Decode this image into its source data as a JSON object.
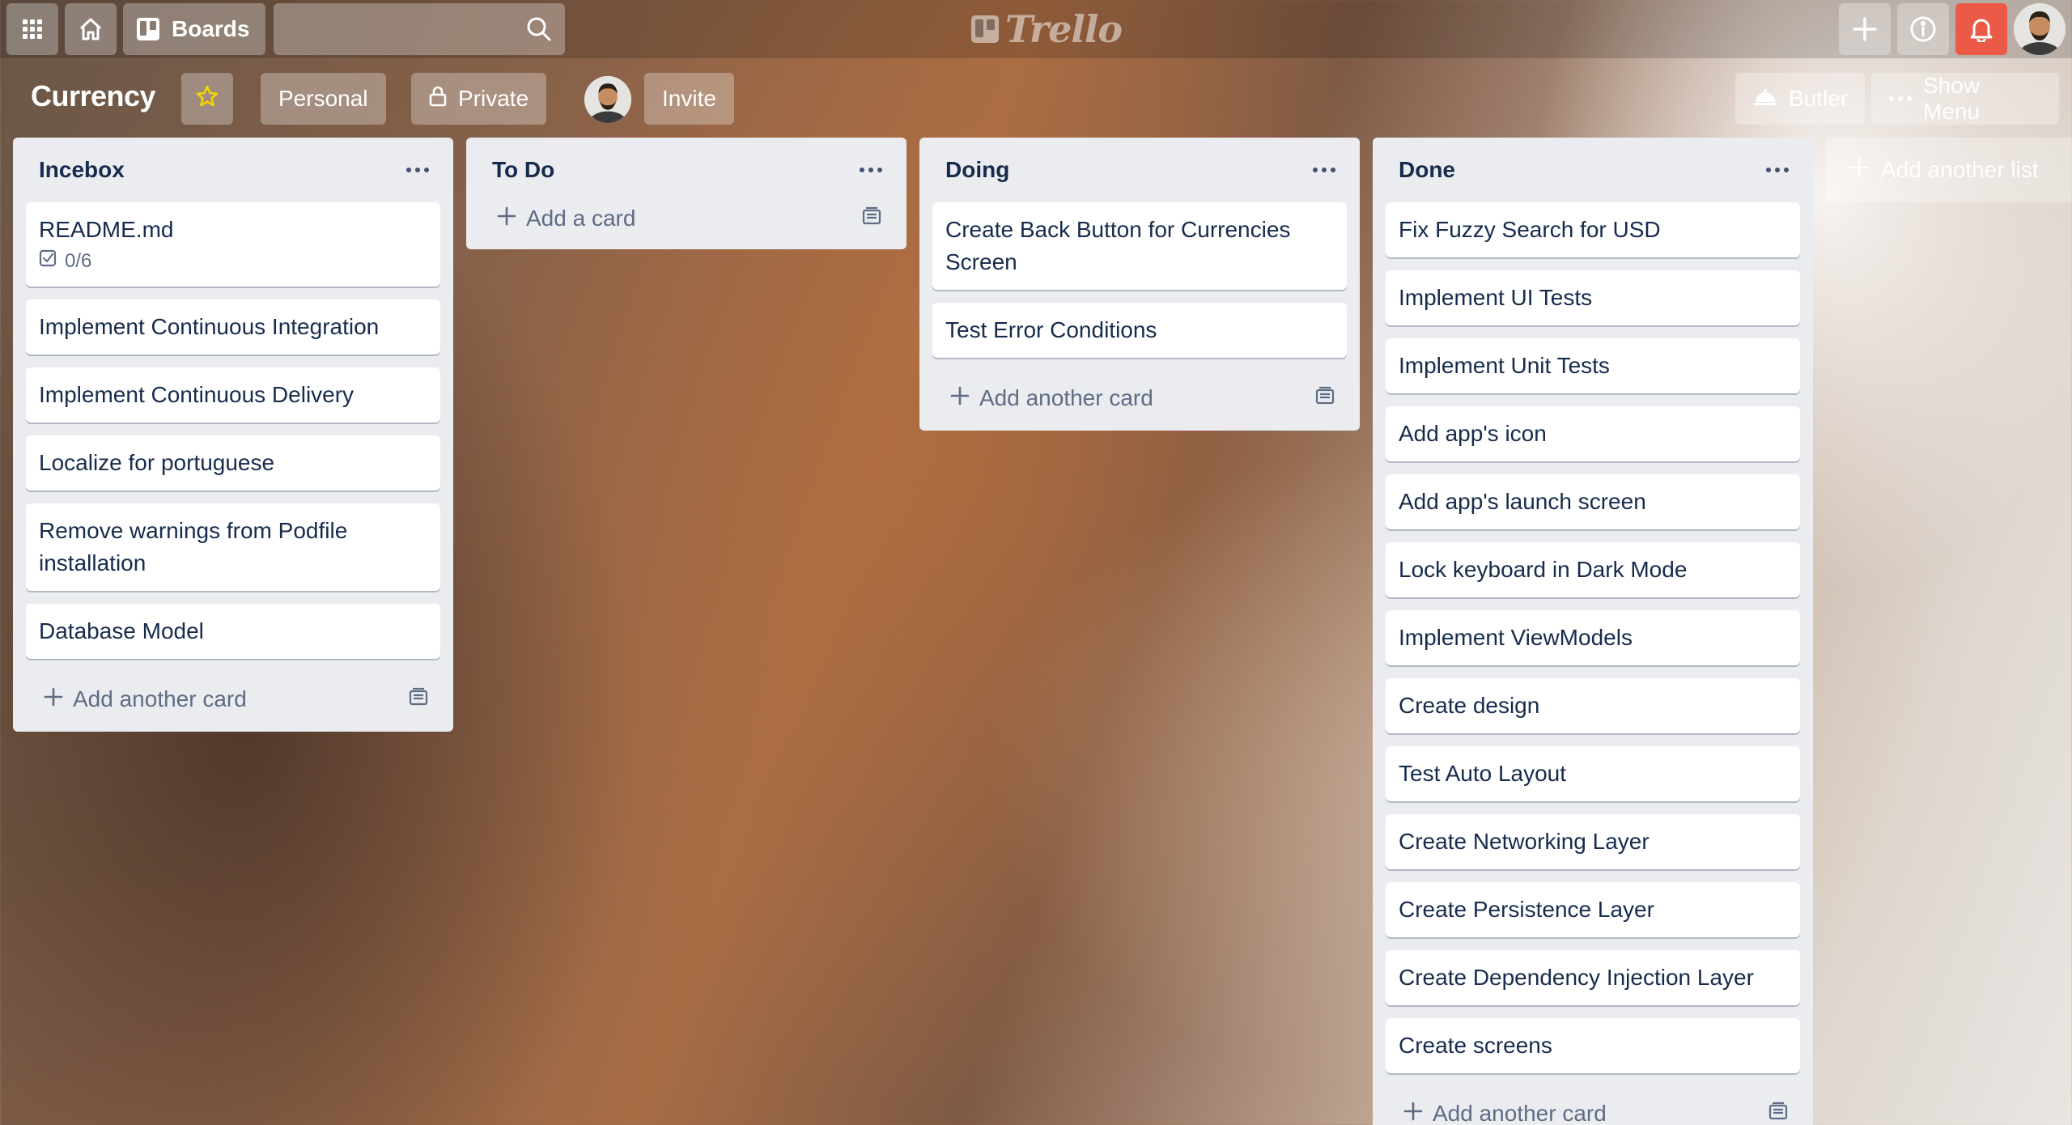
{
  "header": {
    "boards_label": "Boards",
    "search_placeholder": "",
    "logo_text": "Trello",
    "icons": [
      "apps-icon",
      "home-icon",
      "boards-icon",
      "search-icon",
      "plus-icon",
      "info-icon",
      "bell-icon"
    ]
  },
  "board": {
    "title": "Currency",
    "team_label": "Personal",
    "visibility_label": "Private",
    "invite_label": "Invite",
    "butler_label": "Butler",
    "menu_label": "Show Menu"
  },
  "lists": [
    {
      "title": "Incebox",
      "cards": [
        {
          "title": "README.md",
          "checklist": "0/6"
        },
        {
          "title": "Implement Continuous Integration"
        },
        {
          "title": "Implement Continuous Delivery"
        },
        {
          "title": "Localize for portuguese"
        },
        {
          "title": "Remove warnings from Podfile installation"
        },
        {
          "title": "Database Model"
        }
      ],
      "add_label": "Add another card"
    },
    {
      "title": "To Do",
      "cards": [],
      "add_label": "Add a card"
    },
    {
      "title": "Doing",
      "cards": [
        {
          "title": "Create Back Button for Currencies Screen"
        },
        {
          "title": "Test Error Conditions"
        }
      ],
      "add_label": "Add another card"
    },
    {
      "title": "Done",
      "cards": [
        {
          "title": "Fix Fuzzy Search for USD"
        },
        {
          "title": "Implement UI Tests"
        },
        {
          "title": "Implement Unit Tests"
        },
        {
          "title": "Add app's icon"
        },
        {
          "title": "Add app's launch screen"
        },
        {
          "title": "Lock keyboard in Dark Mode"
        },
        {
          "title": "Implement ViewModels"
        },
        {
          "title": "Create design"
        },
        {
          "title": "Test Auto Layout"
        },
        {
          "title": "Create Networking Layer"
        },
        {
          "title": "Create Persistence Layer"
        },
        {
          "title": "Create Dependency Injection Layer"
        },
        {
          "title": "Create screens"
        }
      ],
      "add_label": "Add another card"
    }
  ],
  "add_list_label": "Add another list",
  "colors": {
    "list_bg": "#ebecf0",
    "notification_red": "#eb5a46",
    "star_yellow": "#f2d600"
  }
}
